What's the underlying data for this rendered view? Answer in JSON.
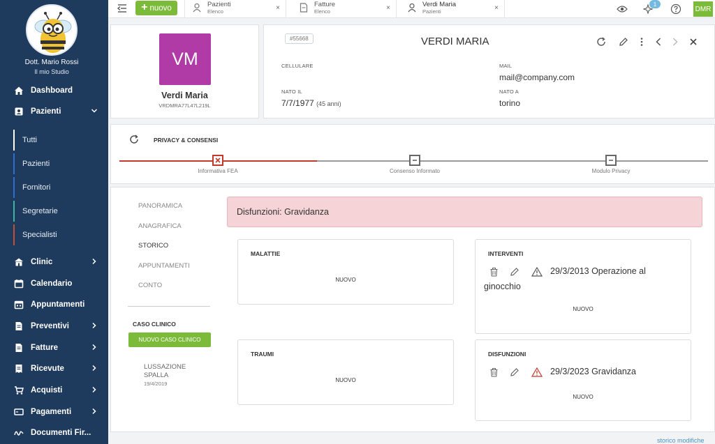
{
  "sidebar": {
    "doctor_name": "Dott. Mario Rossi",
    "studio": "Il mio Studio",
    "items": [
      {
        "label": "Dashboard",
        "icon": "home-icon"
      },
      {
        "label": "Pazienti",
        "icon": "patient-icon"
      },
      {
        "label": "Clinic",
        "icon": "clinic-icon"
      },
      {
        "label": "Calendario",
        "icon": "calendar-icon"
      },
      {
        "label": "Appuntamenti",
        "icon": "appointments-icon"
      },
      {
        "label": "Preventivi",
        "icon": "quote-icon"
      },
      {
        "label": "Fatture",
        "icon": "invoice-icon"
      },
      {
        "label": "Ricevute",
        "icon": "receipt-icon"
      },
      {
        "label": "Acquisti",
        "icon": "cart-icon"
      },
      {
        "label": "Pagamenti",
        "icon": "payment-icon"
      },
      {
        "label": "Documenti Fir..."
      }
    ],
    "subitems": [
      {
        "label": "Tutti",
        "color": "#ffffff"
      },
      {
        "label": "Pazienti",
        "color": "#2f6dd0"
      },
      {
        "label": "Fornitori",
        "color": "#2f6dd0"
      },
      {
        "label": "Segretarie",
        "color": "#3fb3a0"
      },
      {
        "label": "Specialisti",
        "color": "#c0503a"
      }
    ]
  },
  "topbar": {
    "new_label": "nuovo",
    "tabs": [
      {
        "title": "Pazienti",
        "subtitle": "Elenco"
      },
      {
        "title": "Fatture",
        "subtitle": "Elenco"
      },
      {
        "title": "Verdi Maria",
        "subtitle": "Pazienti"
      }
    ],
    "close_glyph": "×",
    "notification_count": "1",
    "user_initials": "DMR"
  },
  "patient": {
    "initials": "VM",
    "name": "Verdi Maria",
    "fiscal_code": "VRDMRA77L47L219L",
    "id": "#55668",
    "title": "VERDI MARIA",
    "fields": {
      "cellulare_label": "CELLULARE",
      "cellulare_value": "",
      "mail_label": "MAIL",
      "mail_value": "mail@company.com",
      "nato_il_label": "NATO IL",
      "nato_il_value": "7/7/1977",
      "age": "(45 anni)",
      "nato_a_label": "NATO A",
      "nato_a_value": "torino"
    }
  },
  "privacy": {
    "title": "PRIVACY & CONSENSI",
    "steps": [
      {
        "label": "Informativa FEA",
        "state": "error"
      },
      {
        "label": "Consenso Informato",
        "state": "pending"
      },
      {
        "label": "Modulo Privacy",
        "state": "pending"
      }
    ],
    "colors": {
      "error": "#c0392b",
      "pending": "#666666"
    }
  },
  "main": {
    "menu": [
      {
        "label": "PANORAMICA",
        "active": false
      },
      {
        "label": "ANAGRAFICA",
        "active": false
      },
      {
        "label": "STORICO",
        "active": true
      },
      {
        "label": "APPUNTAMENTI",
        "active": false
      },
      {
        "label": "CONTO",
        "active": false
      }
    ],
    "caso_clinico_label": "CASO CLINICO",
    "new_case_label": "NUOVO CASO CLINICO",
    "case": {
      "title_line1": "LUSSAZIONE",
      "title_line2": "SPALLA",
      "date": "19/4/2019"
    },
    "alert": "Disfunzioni: Gravidanza",
    "boxes": {
      "malattie": {
        "title": "MALATTIE",
        "new": "NUOVO"
      },
      "interventi": {
        "title": "INTERVENTI",
        "entry_line1": "29/3/2013 Operazione al",
        "entry_line2": "ginocchio",
        "new": "NUOVO"
      },
      "traumi": {
        "title": "TRAUMI",
        "new": "NUOVO"
      },
      "disfunzioni": {
        "title": "DISFUNZIONI",
        "entry": "29/3/2023 Gravidanza",
        "new": "NUOVO"
      }
    },
    "footer_link": "storico modifiche"
  }
}
